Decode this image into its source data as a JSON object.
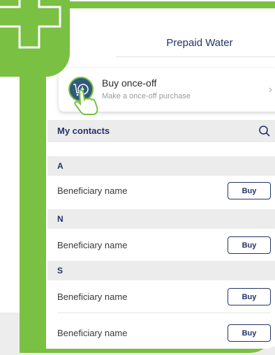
{
  "header": {
    "title": "Prepaid Water"
  },
  "once_off": {
    "title": "Buy once-off",
    "subtitle": "Make a once-off purchase",
    "chevron": "›"
  },
  "contacts": {
    "header_label": "My contacts",
    "sections": [
      {
        "letter": "A",
        "rows": [
          {
            "name": "Beneficiary name",
            "button": "Buy"
          }
        ]
      },
      {
        "letter": "N",
        "rows": [
          {
            "name": "Beneficiary name",
            "button": "Buy"
          }
        ]
      },
      {
        "letter": "S",
        "rows": [
          {
            "name": "Beneficiary name",
            "button": "Buy"
          },
          {
            "name": "Beneficiary name",
            "button": "Buy"
          }
        ]
      }
    ]
  },
  "colors": {
    "accent_green": "#7ac043",
    "navy": "#24336a",
    "section_grey": "#ececec"
  },
  "icons": [
    "plus-step-icon",
    "water-purchase-icon",
    "hand-pointer-icon",
    "chevron-right-icon",
    "search-icon"
  ]
}
